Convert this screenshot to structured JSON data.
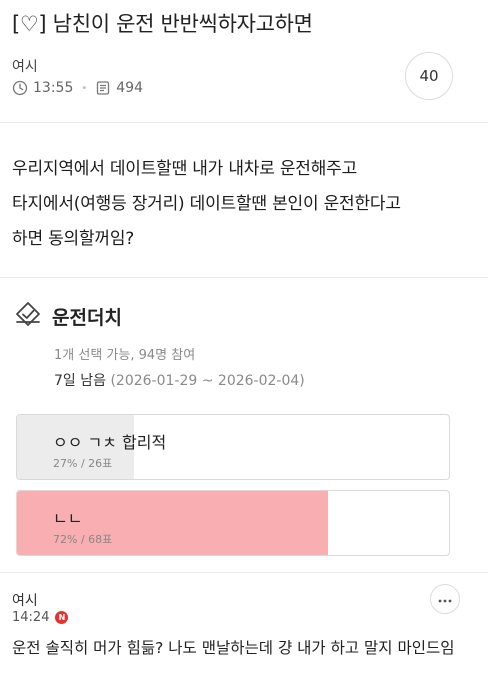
{
  "post": {
    "title": "[♡] 남친이 운전 반반씩하자고하면",
    "author": "여시",
    "time": "13:55",
    "views": "494",
    "comment_count": "40",
    "body_lines": [
      "우리지역에서 데이트할땐 내가 내차로 운전해주고",
      "타지에서(여행등 장거리) 데이트할땐 본인이 운전한다고",
      "하면 동의할꺼임?"
    ]
  },
  "poll": {
    "title": "운전더치",
    "info": "1개 선택 가능, 94명 참여",
    "remaining": "7일 남음",
    "date_range": "(2026-01-29 ~ 2026-02-04)",
    "options": [
      {
        "label": "ㅇㅇ ㄱㅊ 합리적",
        "stat": "27% / 26표",
        "percent": 27,
        "bar_color": "#ececec"
      },
      {
        "label": "ㄴㄴ",
        "stat": "72% / 68표",
        "percent": 72,
        "bar_color": "#f9aeb1"
      }
    ]
  },
  "comment": {
    "author": "여시",
    "time": "14:24",
    "badge": "N",
    "text": "운전 솔직히 머가 힘듦? 나도 맨날하는데 걍 내가 하고 말지 마인드임"
  },
  "icons": {
    "clock": "clock-icon",
    "views": "document-icon",
    "poll": "vote-check-icon",
    "more": "more-icon"
  }
}
